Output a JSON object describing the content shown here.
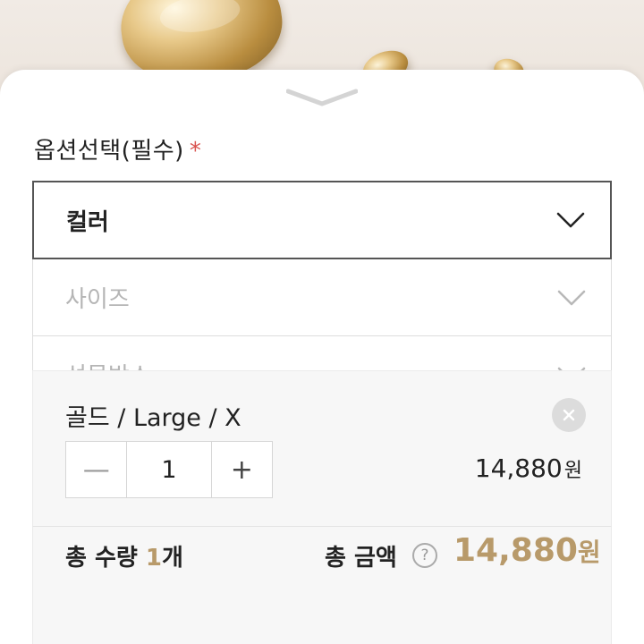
{
  "option_section": {
    "title": "옵션선택(필수)",
    "required_mark": "*"
  },
  "selects": [
    {
      "label": "컬러",
      "state": "active"
    },
    {
      "label": "사이즈",
      "state": "disabled"
    },
    {
      "label": "선물박스",
      "state": "disabled"
    }
  ],
  "selected_item": {
    "name": "골드 / Large / X",
    "quantity": "1",
    "price": "14,880",
    "currency": "원",
    "minus_label": "—",
    "plus_label": "+"
  },
  "summary": {
    "qty_label": "총 수량",
    "qty_value": "1",
    "qty_unit": "개",
    "price_label": "총 금액",
    "help_label": "?",
    "price_value": "14,880",
    "currency": "원"
  },
  "icons": {
    "handle": "chevron-down-icon",
    "dropdown": "chevron-down-icon",
    "remove": "close-icon",
    "help": "help-icon"
  },
  "colors": {
    "accent_gold": "#b89a6a",
    "required_red": "#d9534f"
  }
}
